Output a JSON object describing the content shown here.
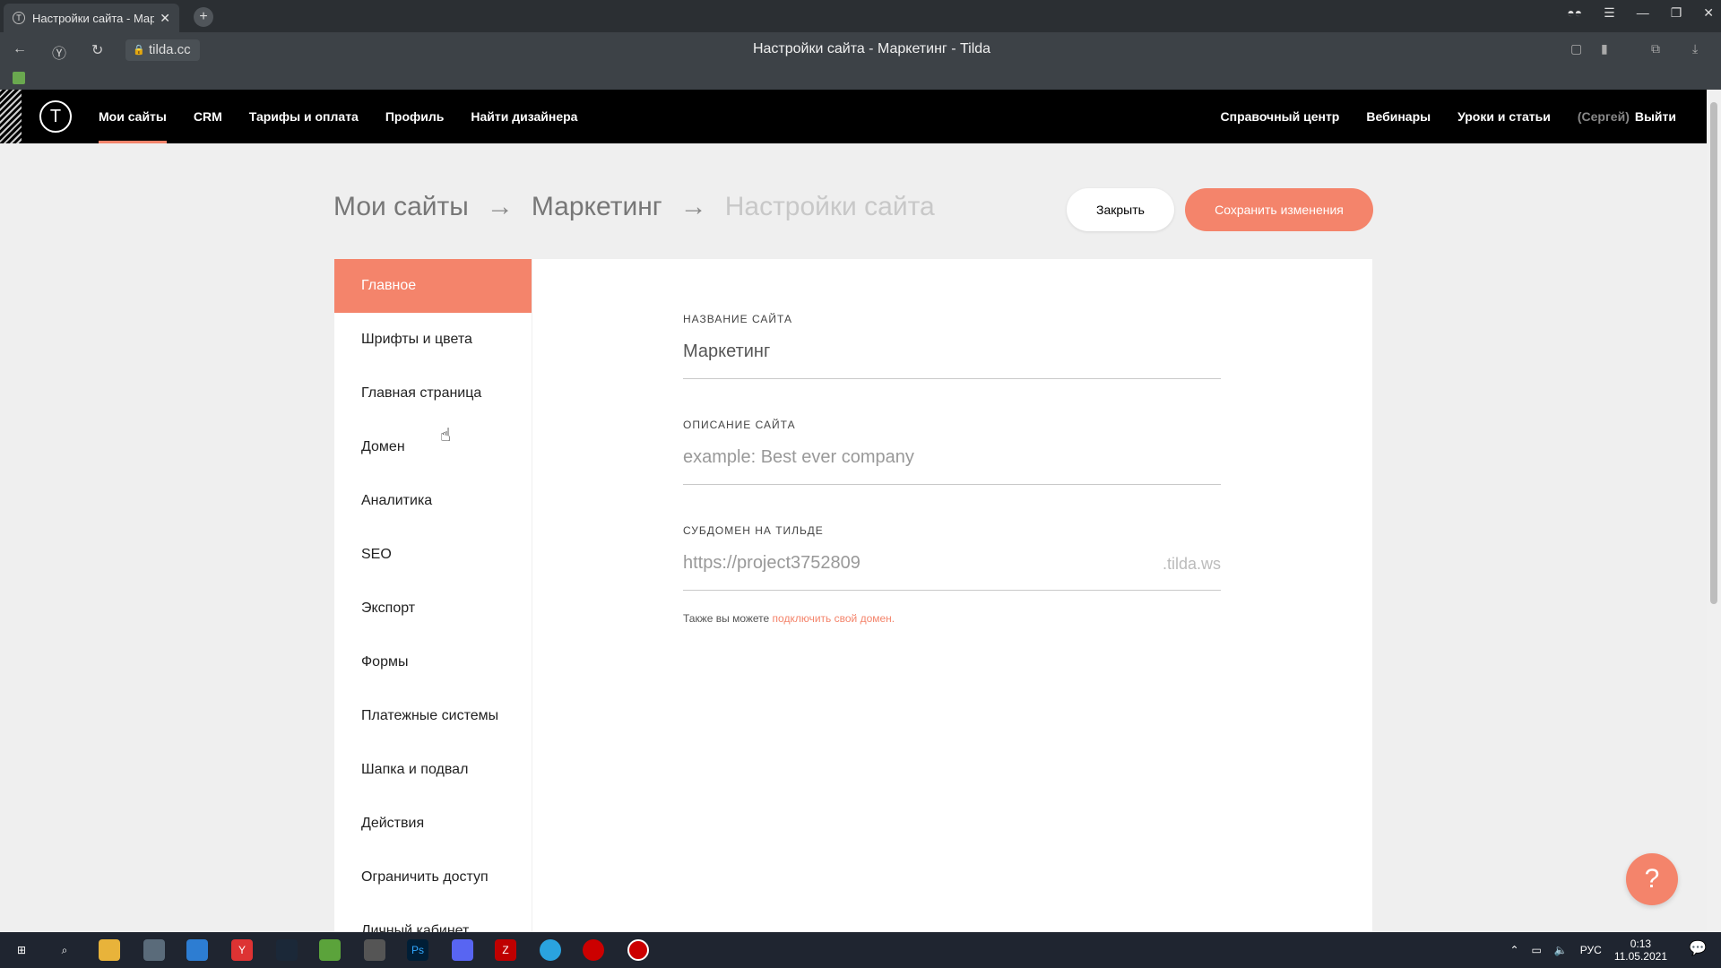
{
  "browser": {
    "tab_title": "Настройки сайта - Мар",
    "tab_close": "✕",
    "new_tab": "+",
    "domain": "tilda.cc",
    "page_title": "Настройки сайта - Маркетинг - Tilda"
  },
  "header": {
    "nav": [
      "Мои сайты",
      "CRM",
      "Тарифы и оплата",
      "Профиль",
      "Найти дизайнера"
    ],
    "right": [
      "Справочный центр",
      "Вебинары",
      "Уроки и статьи"
    ],
    "user": "(Сергей)",
    "logout": "Выйти"
  },
  "breadcrumb": {
    "items": [
      "Мои сайты",
      "Маркетинг",
      "Настройки сайта"
    ],
    "arrow": "→"
  },
  "actions": {
    "close": "Закрыть",
    "save": "Сохранить изменения"
  },
  "sidebar": {
    "items": [
      "Главное",
      "Шрифты и цвета",
      "Главная страница",
      "Домен",
      "Аналитика",
      "SEO",
      "Экспорт",
      "Формы",
      "Платежные системы",
      "Шапка и подвал",
      "Действия",
      "Ограничить доступ",
      "Личный кабинет"
    ]
  },
  "form": {
    "name_label": "НАЗВАНИЕ САЙТА",
    "name_value": "Маркетинг",
    "desc_label": "ОПИСАНИЕ САЙТА",
    "desc_placeholder": "example: Best ever company",
    "subdomain_label": "СУБДОМЕН НА ТИЛЬДЕ",
    "subdomain_value": "https://project3752809",
    "subdomain_suffix": ".tilda.ws",
    "hint_text": "Также вы можете ",
    "hint_link": "подключить свой домен."
  },
  "help": "?",
  "taskbar": {
    "lang": "РУС",
    "time": "0:13",
    "date": "11.05.2021"
  },
  "colors": {
    "accent": "#f4846b",
    "header_bg": "#000000",
    "page_bg": "#efefef"
  }
}
